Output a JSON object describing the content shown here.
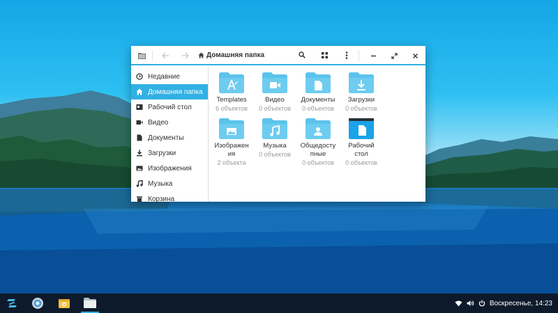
{
  "window": {
    "location_label": "Домашняя папка"
  },
  "sidebar": {
    "items": [
      {
        "label": "Недавние",
        "icon": "clock-icon"
      },
      {
        "label": "Домашняя папка",
        "icon": "home-icon",
        "active": true
      },
      {
        "label": "Рабочий стол",
        "icon": "desktop-icon"
      },
      {
        "label": "Видео",
        "icon": "video-icon"
      },
      {
        "label": "Документы",
        "icon": "document-icon"
      },
      {
        "label": "Загрузки",
        "icon": "download-icon"
      },
      {
        "label": "Изображения",
        "icon": "image-icon"
      },
      {
        "label": "Музыка",
        "icon": "music-icon"
      },
      {
        "label": "Корзина",
        "icon": "trash-icon"
      }
    ]
  },
  "files": [
    {
      "name": "Templates",
      "count": "6 объектов",
      "icon": "templates-folder-icon"
    },
    {
      "name": "Видео",
      "count": "0 объектов",
      "icon": "video-folder-icon"
    },
    {
      "name": "Документы",
      "count": "0 объектов",
      "icon": "documents-folder-icon"
    },
    {
      "name": "Загрузки",
      "count": "0 объектов",
      "icon": "downloads-folder-icon"
    },
    {
      "name": "Изображе­ния",
      "name_lines": [
        "Изображен",
        "ия"
      ],
      "count": "2 объекта",
      "icon": "pictures-folder-icon"
    },
    {
      "name": "Музыка",
      "count": "0 объектов",
      "icon": "music-folder-icon"
    },
    {
      "name_lines": [
        "Общедосту",
        "пные"
      ],
      "count": "0 объектов",
      "icon": "public-folder-icon"
    },
    {
      "name_lines": [
        "Рабочий",
        "стол"
      ],
      "count": "0 объектов",
      "icon": "desktop-folder-icon"
    }
  ],
  "taskbar": {
    "clock": "Воскресенье, 14:23"
  },
  "colors": {
    "accent": "#31b0e3",
    "folder": "#5bc3ec",
    "taskbar": "#0d1a2b"
  }
}
